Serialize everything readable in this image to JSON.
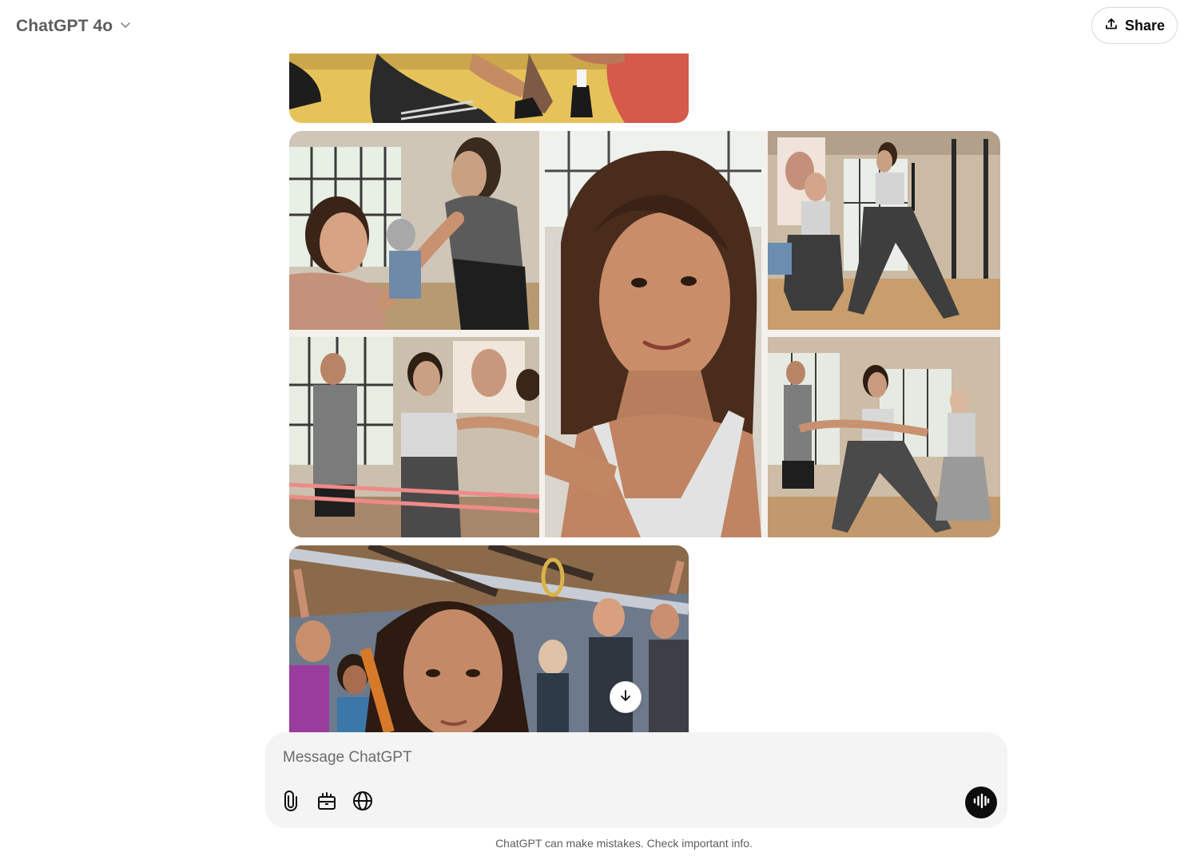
{
  "header": {
    "model_name": "ChatGPT 4o",
    "share_label": "Share"
  },
  "composer": {
    "placeholder": "Message ChatGPT"
  },
  "footer": {
    "disclaimer": "ChatGPT can make mistakes. Check important info."
  },
  "icons": {
    "model_chevron": "chevron-down-icon",
    "share": "upload-icon",
    "attach": "paperclip-icon",
    "tools": "toolbox-icon",
    "search": "globe-icon",
    "voice": "voice-waveform-icon",
    "scroll": "arrow-down-icon"
  },
  "colors": {
    "composer_bg": "#f4f4f4",
    "voice_button": "#0d0d0d",
    "header_text": "#5d5d5d"
  }
}
